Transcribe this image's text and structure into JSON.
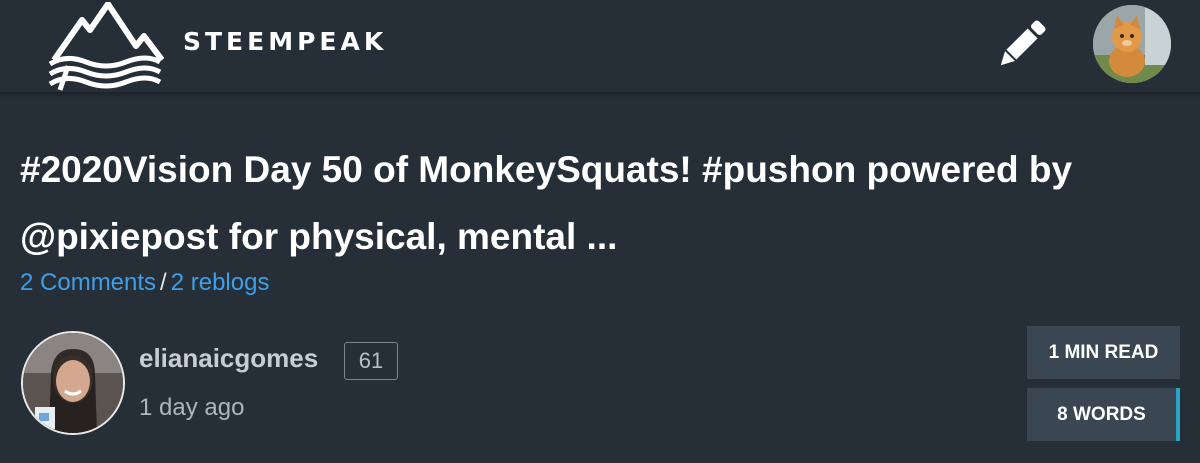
{
  "header": {
    "brand": "STEEMPEAK",
    "logo_icon": "mountain-waves-logo",
    "write_icon": "pencil-icon",
    "user_avatar": "user-avatar-kitten"
  },
  "post": {
    "title": "#2020Vision Day 50 of MonkeySquats! #pushon powered by @pixiepost for physical, mental ...",
    "comments": "2 Comments",
    "separator": "/",
    "reblogs": "2 reblogs"
  },
  "author": {
    "name": "elianaicgomes",
    "reputation": "61",
    "time": "1 day ago"
  },
  "stats": {
    "read_time": "1 MIN READ",
    "words": "8 WORDS"
  },
  "colors": {
    "background": "#262f37",
    "link": "#3f9ee8",
    "pill_bg": "#3a4651",
    "accent": "#2aa3c9"
  }
}
